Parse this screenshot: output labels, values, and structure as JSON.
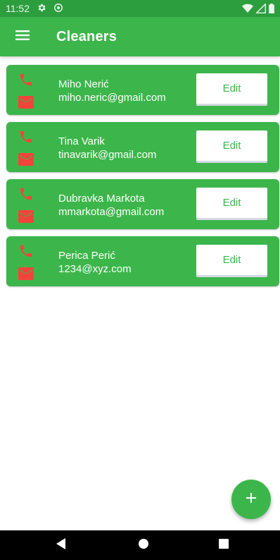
{
  "status_bar": {
    "time": "11:52",
    "icons": [
      "settings-icon",
      "vpn-icon",
      "wifi-icon",
      "signal-icon",
      "battery-icon"
    ]
  },
  "app_bar": {
    "title": "Cleaners",
    "menu_icon": "hamburger-menu-icon"
  },
  "cleaners": [
    {
      "name": "Miho Nerić",
      "email": "miho.neric@gmail.com",
      "edit_label": "Edit"
    },
    {
      "name": "Tina Varik",
      "email": "tinavarik@gmail.com",
      "edit_label": "Edit"
    },
    {
      "name": "Dubravka Markota",
      "email": "mmarkota@gmail.com",
      "edit_label": "Edit"
    },
    {
      "name": "Perica Perić",
      "email": "1234@xyz.com",
      "edit_label": "Edit"
    }
  ],
  "fab": {
    "icon": "add-icon"
  },
  "nav_bar": {
    "icons": [
      "back-icon",
      "home-icon",
      "recents-icon"
    ]
  },
  "colors": {
    "primary": "#3cb64a",
    "status_bar": "#2d9e3d",
    "contact_icon": "#f4433b",
    "card_text": "#ffffff",
    "nav_bar": "#000000"
  }
}
